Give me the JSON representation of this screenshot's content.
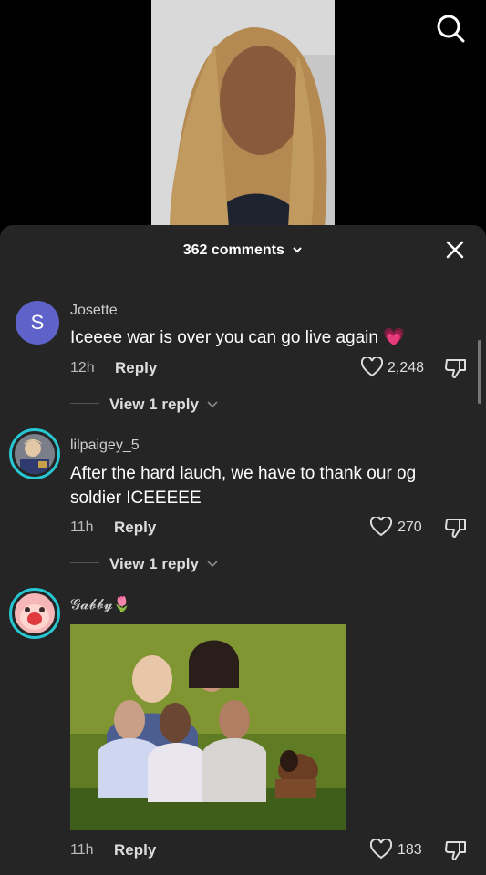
{
  "header": {
    "comment_count": "362 comments"
  },
  "comments": [
    {
      "avatar_letter": "S",
      "username": "Josette",
      "text": "Iceeee war is over you can go live again 💗",
      "time": "12h",
      "reply_label": "Reply",
      "likes": "2,248",
      "view_replies": "View 1 reply"
    },
    {
      "username": "lilpaigey_5",
      "text": "After the hard lauch, we have to thank our og soldier ICEEEEE",
      "time": "11h",
      "reply_label": "Reply",
      "likes": "270",
      "view_replies": "View 1 reply"
    },
    {
      "username": "𝓖𝓪𝓫𝓫𝔂🌷",
      "time": "11h",
      "reply_label": "Reply",
      "likes": "183"
    }
  ],
  "colors": {
    "sheet_bg": "#252525",
    "ring": "#27c6d1",
    "avatar_s": "#5f63c9"
  }
}
